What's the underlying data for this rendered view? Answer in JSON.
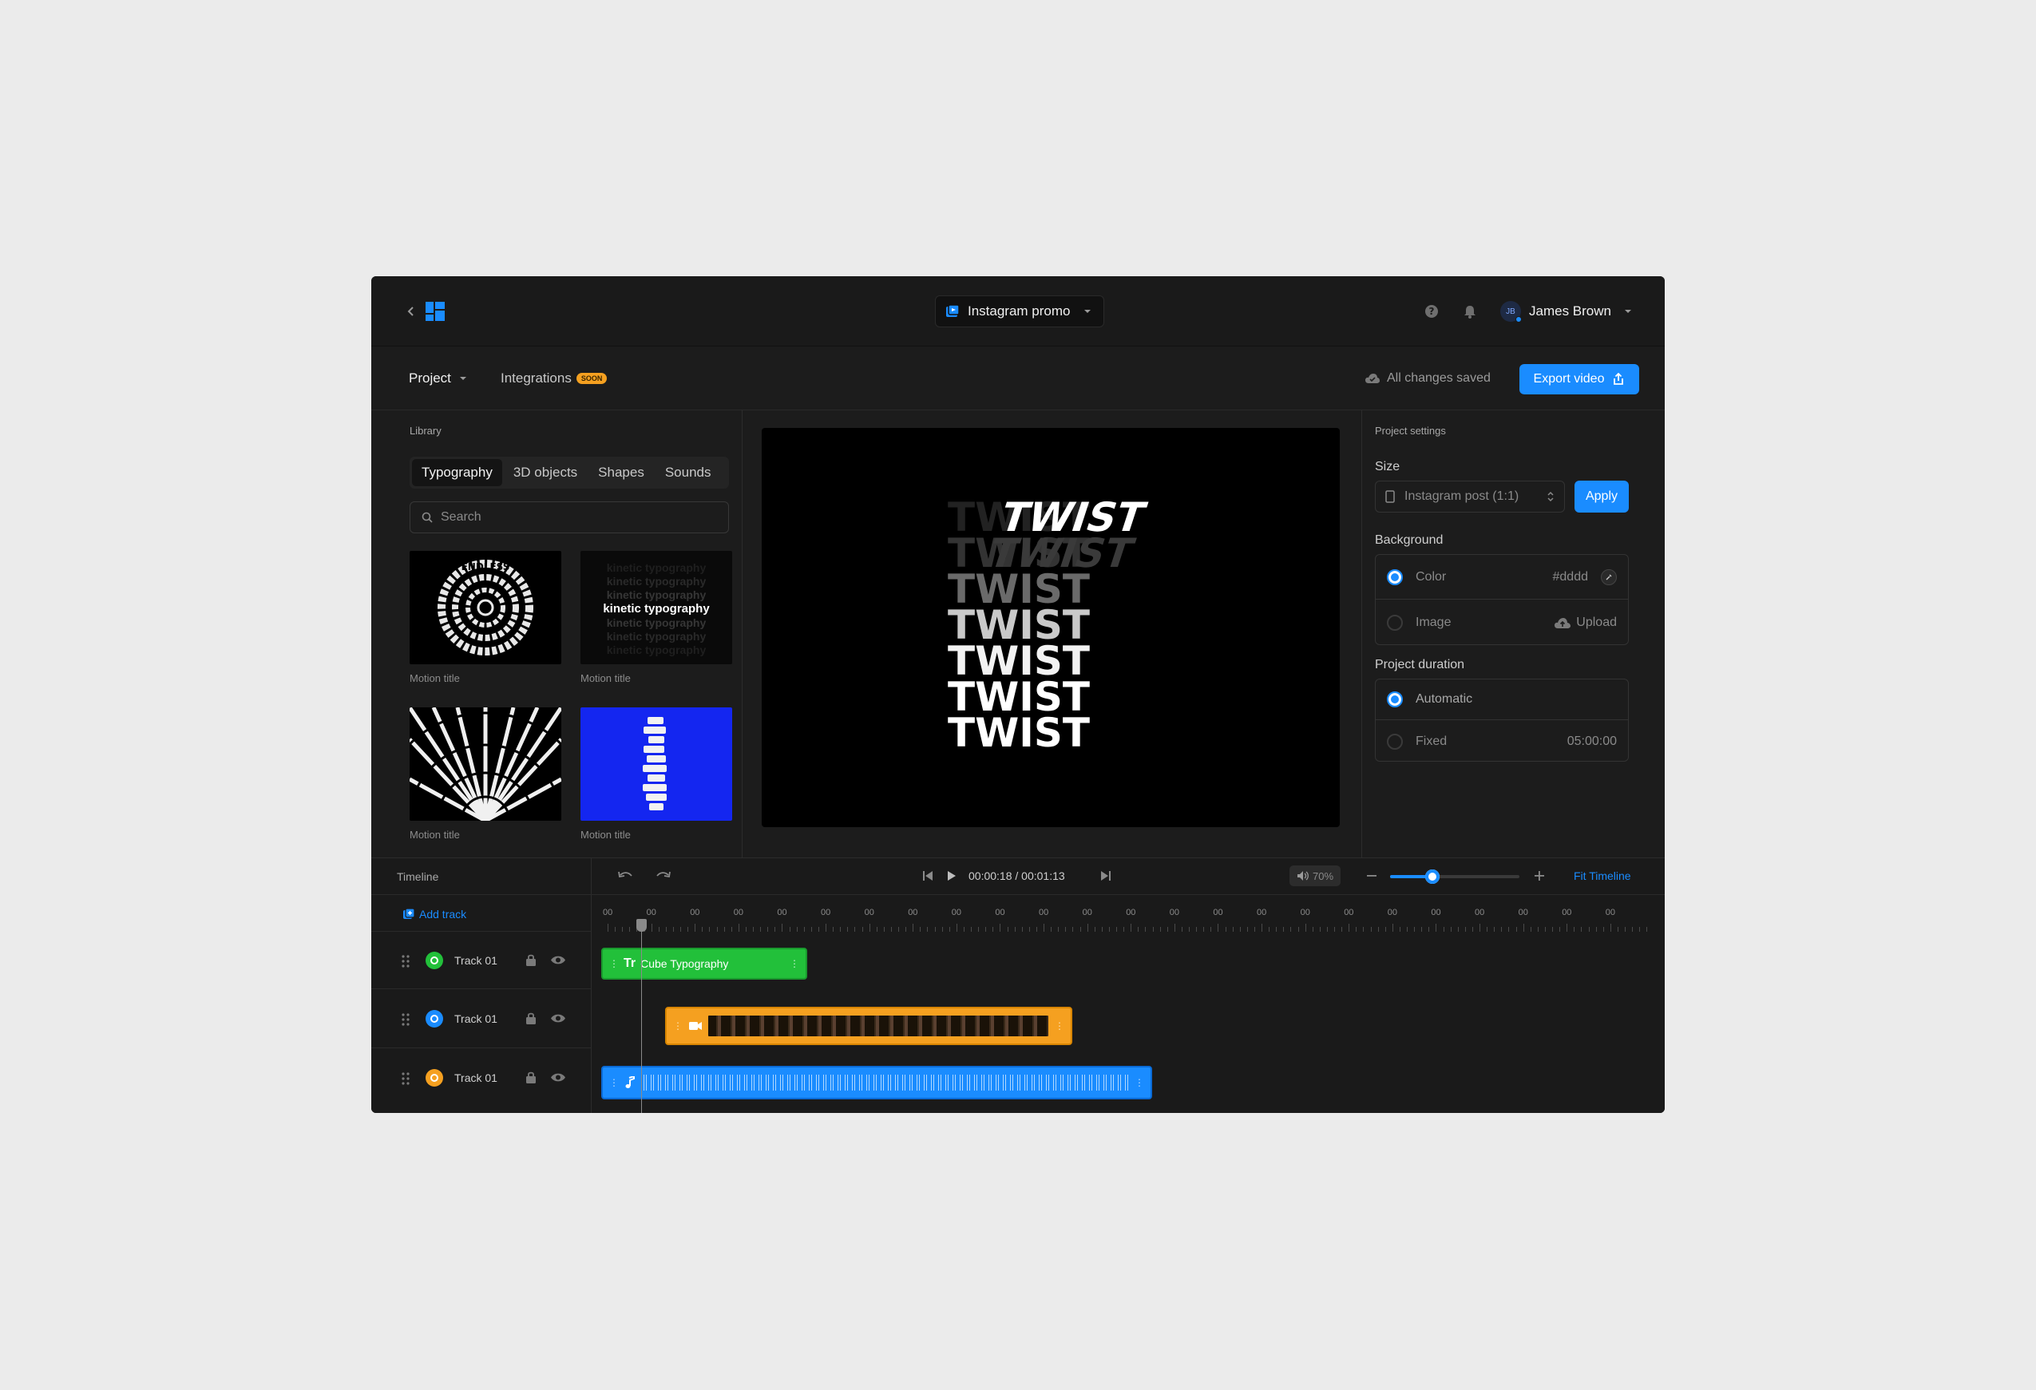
{
  "header": {
    "project_name": "Instagram promo",
    "user_initials": "JB",
    "user_name": "James Brown"
  },
  "subbar": {
    "project_menu": "Project",
    "integrations": "Integrations",
    "soon_badge": "SOON",
    "save_status": "All changes saved",
    "export_label": "Export video"
  },
  "library": {
    "title": "Library",
    "tabs": [
      "Typography",
      "3D objects",
      "Shapes",
      "Sounds"
    ],
    "search_placeholder": "Search",
    "items": [
      {
        "caption": "Motion title",
        "art": "ENDLESS"
      },
      {
        "caption": "Motion title",
        "art": "kinetic typography"
      },
      {
        "caption": "Motion title",
        "art": "RAINBOWS"
      },
      {
        "caption": "Motion title",
        "art": "TYPO"
      }
    ]
  },
  "preview": {
    "words": [
      "TWIST",
      "TWIST",
      "TWIST",
      "TWIST",
      "TWIST",
      "TWIST",
      "TWIST"
    ]
  },
  "settings": {
    "title": "Project settings",
    "size_label": "Size",
    "size_value": "Instagram post (1:1)",
    "apply_label": "Apply",
    "background_label": "Background",
    "color_label": "Color",
    "color_value": "#dddd",
    "image_label": "Image",
    "upload_label": "Upload",
    "duration_label": "Project duration",
    "automatic_label": "Automatic",
    "fixed_label": "Fixed",
    "fixed_value": "05:00:00"
  },
  "timeline": {
    "title": "Timeline",
    "add_track": "Add track",
    "time": "00:00:18 / 00:01:13",
    "volume": "70%",
    "zoom_fraction": 0.33,
    "fit_label": "Fit Timeline",
    "ruler_label": "00",
    "tracks": [
      {
        "name": "Track 01",
        "color": "#22c03a",
        "clip": "Cube Typography"
      },
      {
        "name": "Track 01",
        "color": "#1a8cff",
        "clip": ""
      },
      {
        "name": "Track 01",
        "color": "#f5a020",
        "clip": ""
      }
    ]
  },
  "colors": {
    "accent": "#1a8cff",
    "green": "#22c03a",
    "orange": "#f5a020"
  }
}
